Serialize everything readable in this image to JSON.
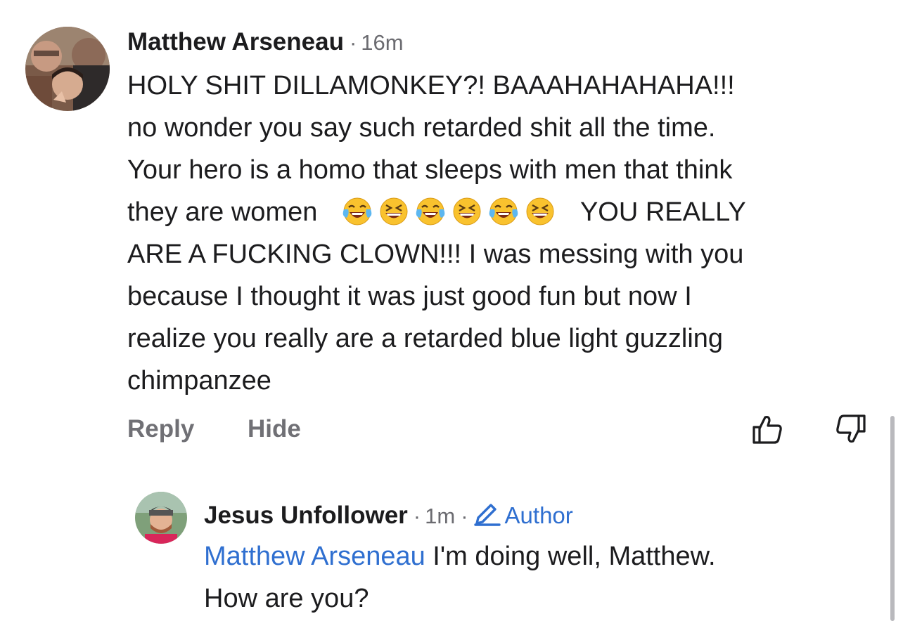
{
  "comments": {
    "main": {
      "author": "Matthew Arseneau",
      "separator": "·",
      "time": "16m",
      "lines": [
        "HOLY SHIT DILLAMONKEY?! BAAAHAHAHAHA!!!",
        "no wonder you say such retarded shit all the time.",
        "Your hero is a homo that sleeps with men that think",
        "they are women",
        "YOU REALLY",
        "ARE A FUCKING CLOWN!!! I was messing with you",
        "because I thought it was just good fun but now I",
        "realize you really are a retarded blue light guzzling",
        "chimpanzee"
      ],
      "emojis": [
        "tears-of-joy-emoji",
        "grinning-squinting-emoji",
        "tears-of-joy-emoji",
        "grinning-squinting-emoji",
        "tears-of-joy-emoji",
        "grinning-squinting-emoji"
      ],
      "actions": {
        "reply_label": "Reply",
        "hide_label": "Hide"
      },
      "icons": {
        "like": "thumbs-up-icon",
        "dislike": "thumbs-down-icon"
      }
    },
    "reply": {
      "author": "Jesus Unfollower",
      "separator": "·",
      "time": "1m",
      "separator2": "·",
      "badge_label": "Author",
      "badge_icon": "pencil-icon",
      "mention": "Matthew Arseneau",
      "text_line1": " I'm doing well, Matthew.",
      "text_line2": "How are you?"
    }
  },
  "colors": {
    "link": "#2f6fd0",
    "text": "#1c1c1e",
    "muted": "#707075"
  }
}
